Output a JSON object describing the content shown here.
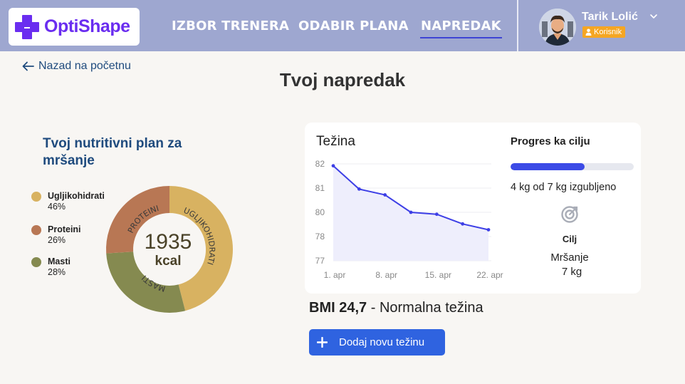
{
  "header": {
    "logo_text": "OptiShape",
    "brand_color": "#6a2df0",
    "nav": [
      {
        "label": "IZBOR TRENERA"
      },
      {
        "label": "ODABIR PLANA"
      },
      {
        "label": "NAPREDAK",
        "active": true
      }
    ],
    "user": {
      "name": "Tarik Lolić",
      "role": "Korisnik"
    }
  },
  "back_link": "Nazad na početnu",
  "page_title": "Tvoj napredak",
  "nutrition": {
    "title": "Tvoj nutritivni plan za mršanje",
    "calories": "1935",
    "unit": "kcal",
    "macros": [
      {
        "name": "Ugljikohidrati",
        "percent": "46%",
        "ring_label": "UGLJIKOHIDRATI",
        "value": 46,
        "color": "#d8b261"
      },
      {
        "name": "Proteini",
        "percent": "26%",
        "ring_label": "PROTEINI",
        "value": 26,
        "color": "#b87754"
      },
      {
        "name": "Masti",
        "percent": "28%",
        "ring_label": "MASTI",
        "value": 28,
        "color": "#858a50"
      }
    ]
  },
  "weight_chart": {
    "title": "Težina",
    "chart_data": {
      "type": "area",
      "x": [
        "1. apr",
        "4. apr",
        "8. apr",
        "11. apr",
        "15. apr",
        "18. apr",
        "22. apr"
      ],
      "xticks": [
        "1. apr",
        "8. apr",
        "15. apr",
        "22. apr"
      ],
      "series": [
        {
          "values": [
            81.9,
            80.7,
            80.4,
            79.5,
            79.4,
            78.9,
            78.6
          ]
        }
      ],
      "yticks": [
        "82",
        "81",
        "80",
        "78",
        "77"
      ],
      "line_color": "#3d3fe6"
    }
  },
  "progress": {
    "title": "Progres ka cilju",
    "fraction": 0.6,
    "text": "4 kg od 7 kg izgubljeno",
    "goal_label": "Cilj",
    "goal_type": "Mršanje",
    "goal_weight": "7 kg"
  },
  "bmi": {
    "value": "BMI 24,7",
    "separator": "-",
    "category": "Normalna težina"
  },
  "add_button": "Dodaj novu težinu"
}
